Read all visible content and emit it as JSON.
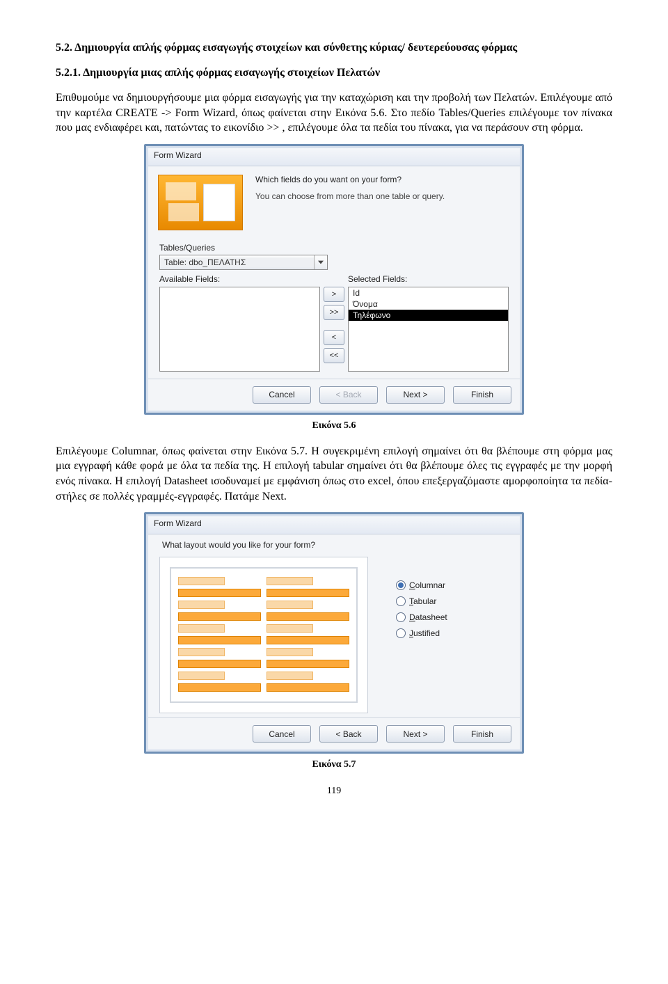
{
  "section": {
    "num": "5.2.",
    "title": "Δημιουργία απλής φόρμας εισαγωγής στοιχείων και σύνθετης κύριας/ δευτερεύουσας φόρμας",
    "sub_num": "5.2.1.",
    "sub_title": "Δημιουργία μιας απλής φόρμας εισαγωγής στοιχείων Πελατών"
  },
  "para1": "Επιθυμούμε να δημιουργήσουμε μια φόρμα εισαγωγής για την καταχώριση και την προβολή των Πελατών. Επιλέγουμε από την καρτέλα CREATE -> Form Wizard, όπως φαίνεται στην Εικόνα 5.6. Στο πεδίο Tables/Queries επιλέγουμε τον πίνακα που μας ενδιαφέρει και, πατώντας το εικονίδιο  >> , επιλέγουμε όλα τα πεδία του πίνακα, για να περάσουν στη φόρμα.",
  "figA": {
    "caption": "Εικόνα 5.6"
  },
  "para2": "Επιλέγουμε Columnar, όπως φαίνεται στην Εικόνα 5.7. Η συγεκριμένη επιλογή σημαίνει ότι θα βλέπουμε στη φόρμα μας μια εγγραφή κάθε φορά με όλα τα πεδία της. Η επιλογή tabular σημαίνει ότι θα βλέπουμε όλες τις εγγραφές με την μορφή ενός πίνακα. Η επιλογή Datasheet ισοδυναμεί με εμφάνιση όπως στο excel, όπου επεξεργαζόμαστε αμορφοποίητα τα πεδία-στήλες σε πολλές γραμμές-εγγραφές. Πατάμε Next.",
  "figB": {
    "caption": "Εικόνα 5.7"
  },
  "pageNum": "119",
  "wizA": {
    "title": "Form Wizard",
    "q_main": "Which fields do you want on your form?",
    "q_sub": "You can choose from more than one table or query.",
    "tables_label": "Tables/Queries",
    "combo_value": "Table: dbo_ΠΕΛΑΤΗΣ",
    "avail_label": "Available Fields:",
    "sel_label": "Selected Fields:",
    "sel_items": [
      "Id",
      "Όνομα",
      "Τηλέφωνο"
    ],
    "move_one": ">",
    "move_all": ">>",
    "back_one": "<",
    "back_all": "<<",
    "btn_cancel": "Cancel",
    "btn_back": "< Back",
    "btn_next": "Next >",
    "btn_finish": "Finish"
  },
  "wizB": {
    "title": "Form Wizard",
    "question": "What layout would you like for your form?",
    "options": [
      "Columnar",
      "Tabular",
      "Datasheet",
      "Justified"
    ],
    "selected": "Columnar",
    "btn_cancel": "Cancel",
    "btn_back": "< Back",
    "btn_next": "Next >",
    "btn_finish": "Finish"
  }
}
